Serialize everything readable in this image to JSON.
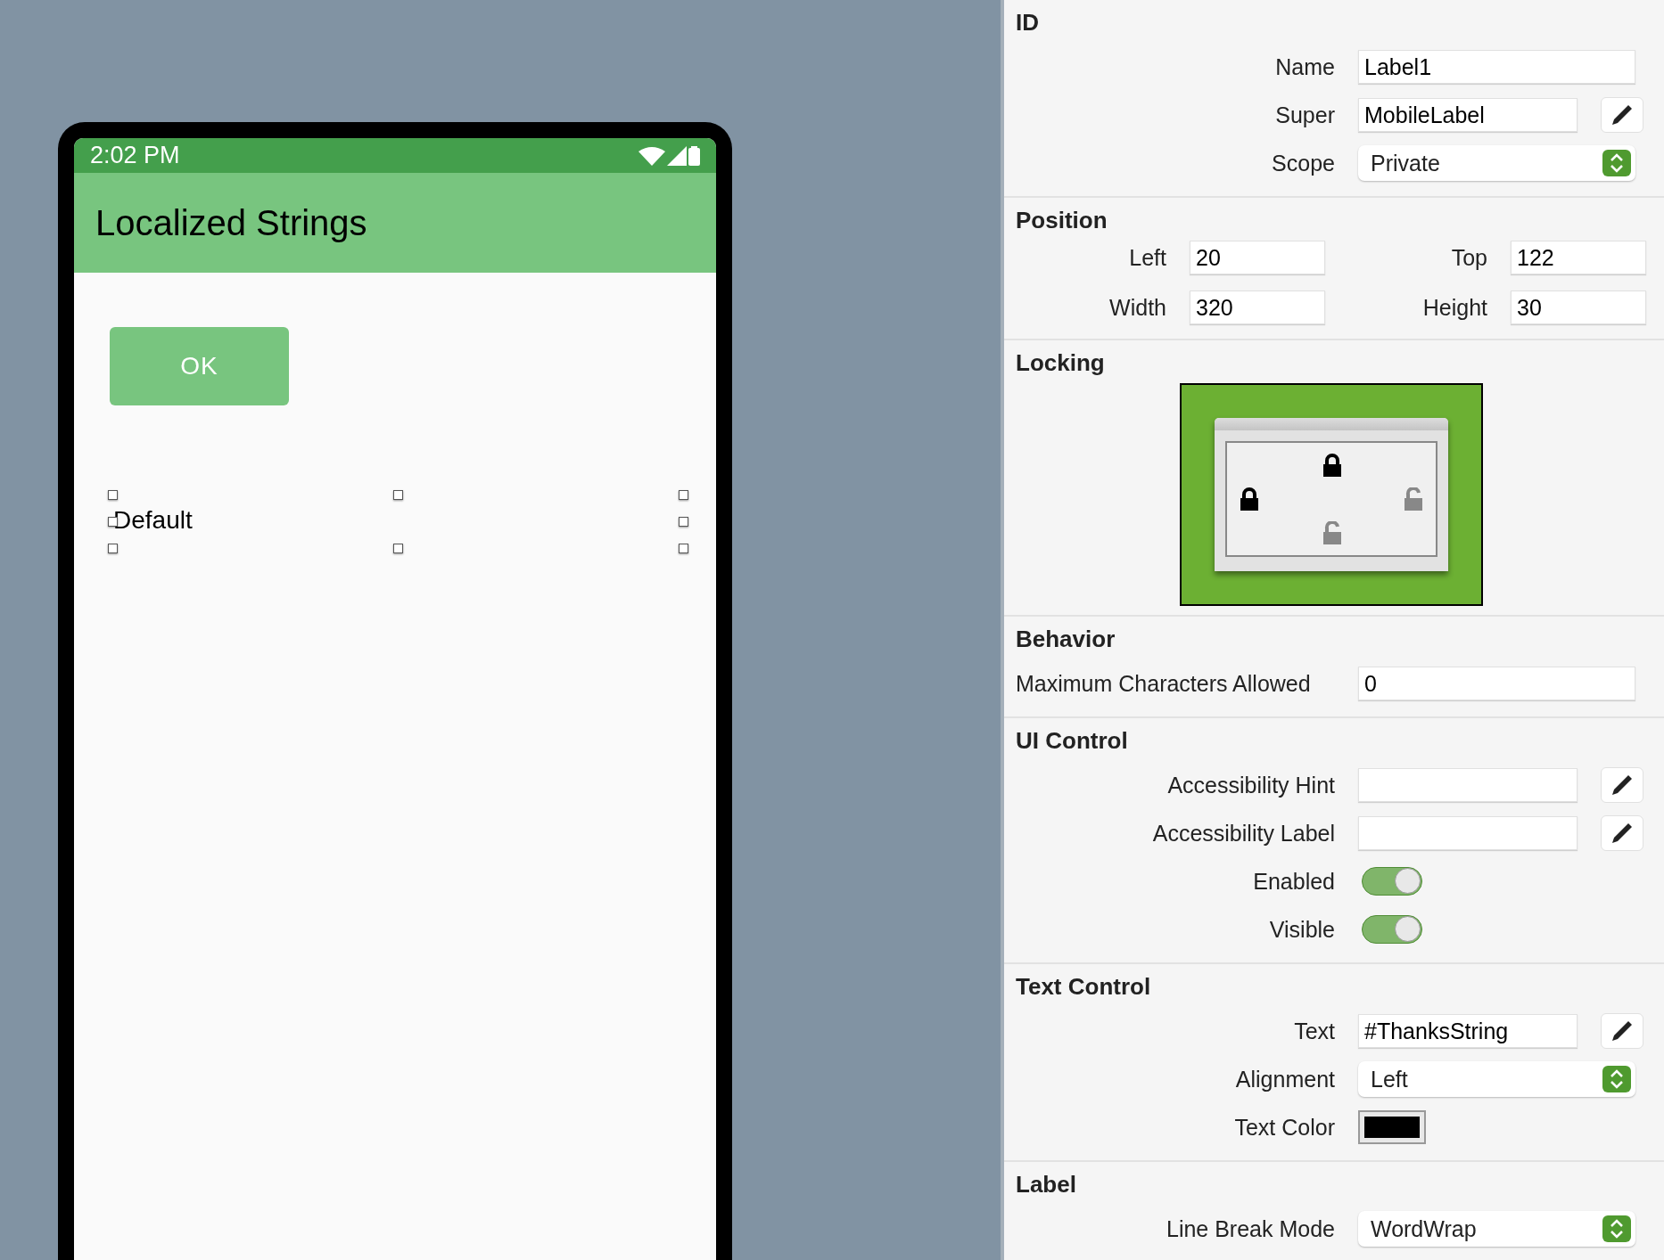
{
  "phone": {
    "status_time": "2:02 PM",
    "title": "Localized Strings",
    "button": "OK",
    "label": "Default"
  },
  "inspector": {
    "sections": [
      {
        "kind": "form",
        "heading": "ID",
        "rows": [
          {
            "kind": "text",
            "label": "Name",
            "value": "Label1"
          },
          {
            "kind": "text_edit",
            "label": "Super",
            "value": "MobileLabel"
          },
          {
            "kind": "select",
            "label": "Scope",
            "value": "Private"
          }
        ]
      },
      {
        "kind": "position",
        "heading": "Position",
        "rows": [
          {
            "label": "Left",
            "value": "20"
          },
          {
            "label": "Top",
            "value": "122"
          },
          {
            "label": "Width",
            "value": "320"
          },
          {
            "label": "Height",
            "value": "30"
          }
        ]
      },
      {
        "kind": "locking",
        "heading": "Locking",
        "locks": [
          {
            "kind": "top",
            "locked": true
          },
          {
            "kind": "left",
            "locked": true
          },
          {
            "kind": "right",
            "locked": false
          },
          {
            "kind": "bottom",
            "locked": false
          }
        ]
      },
      {
        "kind": "wide",
        "heading": "Behavior",
        "rows": [
          {
            "kind": "text",
            "label": "Maximum Characters Allowed",
            "value": "0"
          }
        ]
      },
      {
        "kind": "form",
        "heading": "UI Control",
        "rows": [
          {
            "kind": "text_edit",
            "label": "Accessibility Hint"
          },
          {
            "kind": "text_edit",
            "label": "Accessibility Label"
          },
          {
            "kind": "toggle",
            "label": "Enabled",
            "on": true
          },
          {
            "kind": "toggle",
            "label": "Visible",
            "on": true
          }
        ]
      },
      {
        "kind": "form",
        "heading": "Text Control",
        "rows": [
          {
            "kind": "text_edit",
            "label": "Text",
            "value": "#ThanksString"
          },
          {
            "kind": "select",
            "label": "Alignment",
            "value": "Left"
          },
          {
            "kind": "color",
            "label": "Text Color",
            "color": "#000000"
          }
        ]
      },
      {
        "kind": "form",
        "heading": "Label",
        "rows": [
          {
            "kind": "select",
            "label": "Line Break Mode",
            "value": "WordWrap"
          }
        ]
      }
    ]
  }
}
